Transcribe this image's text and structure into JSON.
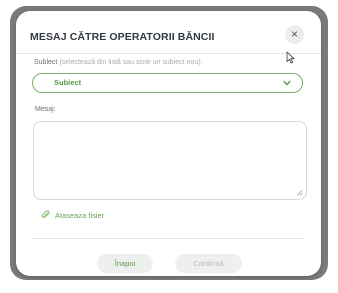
{
  "dialog": {
    "title": "MESAJ CĂTRE OPERATORII BĂNCII",
    "close_glyph": "×",
    "close_icon": "close-icon"
  },
  "subject": {
    "label": "Sublect",
    "hint": "(selectează din listă sau scrie un subiect nou):",
    "value": "Subiect",
    "chevron_icon": "chevron-down-icon"
  },
  "message": {
    "label": "Mesaj:",
    "value": ""
  },
  "attach": {
    "icon": "paperclip-icon",
    "label": "Ataseaza fisier"
  },
  "buttons": {
    "back": "Înapoi",
    "confirm": "Confirmă"
  },
  "colors": {
    "accent": "#5a9a48",
    "border_accent": "#7fae6f",
    "backdrop": "#7a7a7a"
  }
}
